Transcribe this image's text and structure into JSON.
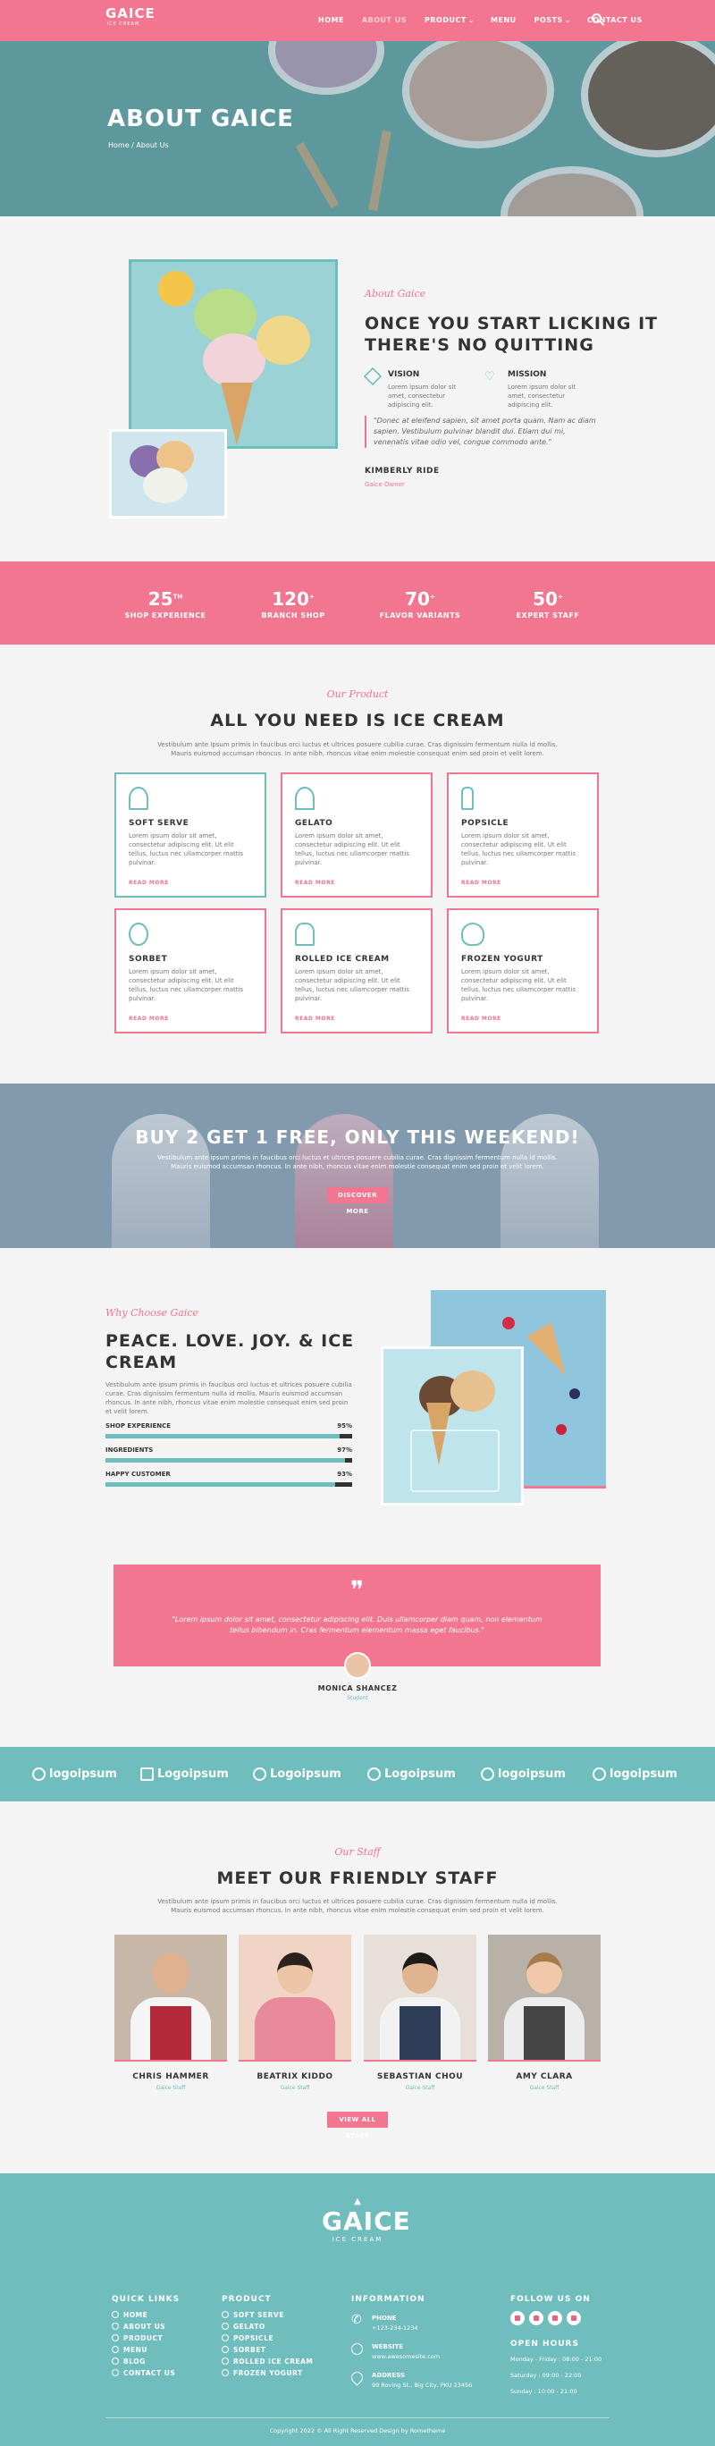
{
  "brand": {
    "name": "GAICE",
    "tagline": "ICE CREAM"
  },
  "nav": [
    "HOME",
    "ABOUT US",
    "PRODUCT",
    "MENU",
    "POSTS",
    "CONTACT US"
  ],
  "hero": {
    "title": "ABOUT GAICE",
    "breadcrumb": "Home / About Us"
  },
  "about": {
    "script": "About Gaice",
    "title1": "ONCE YOU START LICKING IT",
    "title2": "THERE'S NO QUITTING",
    "vision": "VISION",
    "vision_text": "Lorem ipsum dolor sit amet, consectetur adipiscing elit.",
    "mission": "MISSION",
    "mission_text": "Lorem ipsum dolor sit amet, consectetur adipiscing elit.",
    "quote": "\"Donec at eleifend sapien, sit amet porta quam. Nam ac diam sapien. Vestibulum pulvinar blandit dui. Etiam dui mi, venenatis vitae odio vel, congue commodo ante.\"",
    "name": "KIMBERLY RIDE",
    "role": "Gaice Owner"
  },
  "stats": [
    {
      "n": "25",
      "s": "TH",
      "l": "SHOP EXPERIENCE"
    },
    {
      "n": "120",
      "s": "+",
      "l": "BRANCH SHOP"
    },
    {
      "n": "70",
      "s": "+",
      "l": "FLAVOR VARIANTS"
    },
    {
      "n": "50",
      "s": "+",
      "l": "EXPERT STAFF"
    }
  ],
  "products": {
    "script": "Our Product",
    "title": "ALL YOU NEED IS ICE CREAM",
    "desc": "Vestibulum ante ipsum primis in faucibus orci luctus et ultrices posuere cubilia curae. Cras dignissim fermentum nulla id mollis. Mauris euismod accumsan rhoncus. In ante nibh, rhoncus vitae enim molestie consequat enim sed proin et velit lorem.",
    "items": [
      {
        "t": "SOFT SERVE"
      },
      {
        "t": "GELATO"
      },
      {
        "t": "POPSICLE"
      },
      {
        "t": "SORBET"
      },
      {
        "t": "ROLLED ICE CREAM"
      },
      {
        "t": "FROZEN YOGURT"
      }
    ],
    "item_text": "Lorem ipsum dolor sit amet, consectetur adipiscing elit. Ut elit tellus, luctus nec ullamcorper mattis pulvinar.",
    "read": "READ MORE"
  },
  "promo": {
    "title": "BUY 2 GET 1 FREE, ONLY THIS WEEKEND!",
    "desc": "Vestibulum ante ipsum primis in faucibus orci luctus et ultrices posuere cubilia curae. Cras dignissim fermentum nulla id mollis. Mauris euismod accumsan rhoncus. In ante nibh, rhoncus vitae enim molestie consequat enim sed proin et velit lorem.",
    "button": "DISCOVER MORE"
  },
  "why": {
    "script": "Why Choose Gaice",
    "title1": "PEACE. LOVE. JOY. & ICE",
    "title2": "CREAM",
    "desc": "Vestibulum ante ipsum primis in faucibus orci luctus et ultrices posuere cubilia curae. Cras dignissim fermentum nulla id mollis. Mauris euismod accumsan rhoncus. In ante nibh, rhoncus vitae enim molestie consequat enim sed proin et velit lorem.",
    "bars": [
      {
        "l": "SHOP EXPERIENCE",
        "p": "95%",
        "v": 95
      },
      {
        "l": "INGREDIENTS",
        "p": "97%",
        "v": 97
      },
      {
        "l": "HAPPY CUSTOMER",
        "p": "93%",
        "v": 93
      }
    ]
  },
  "testimonial": {
    "quote": "\"Lorem ipsum dolor sit amet, consectetur adipiscing elit. Duis ullamcorper diam quam, non elementum tellus bibendum in. Cras fermentum elementum massa eget faucibus.\"",
    "name": "MONICA SHANCEZ",
    "role": "Student"
  },
  "logos": [
    "logoipsum",
    "Logoipsum",
    "Logoipsum",
    "Logoipsum",
    "logoipsum",
    "logoipsum"
  ],
  "staff": {
    "script": "Our Staff",
    "title": "MEET OUR FRIENDLY STAFF",
    "desc": "Vestibulum ante ipsum primis in faucibus orci luctus et ultrices posuere cubilia curae. Cras dignissim fermentum nulla id mollis. Mauris euismod accumsan rhoncus. In ante nibh, rhoncus vitae enim molestie consequat enim sed proin et velit lorem.",
    "people": [
      {
        "n": "CHRIS HAMMER",
        "r": "Gaice Staff"
      },
      {
        "n": "BEATRIX KIDDO",
        "r": "Gaice Staff"
      },
      {
        "n": "SEBASTIAN CHOU",
        "r": "Gaice Staff"
      },
      {
        "n": "AMY CLARA",
        "r": "Gaice Staff"
      }
    ],
    "button": "VIEW ALL STAFF"
  },
  "footer": {
    "quick": "QUICK LINKS",
    "quick_items": [
      "HOME",
      "ABOUT US",
      "PRODUCT",
      "MENU",
      "BLOG",
      "CONTACT US"
    ],
    "product": "PRODUCT",
    "product_items": [
      "SOFT SERVE",
      "GELATO",
      "POPSICLE",
      "SORBET",
      "ROLLED ICE CREAM",
      "FROZEN YOGURT"
    ],
    "info": "INFORMATION",
    "phone_l": "PHONE",
    "phone": "+123-234-1234",
    "web_l": "WEBSITE",
    "web": "www.awesomesite.com",
    "addr_l": "ADDRESS",
    "addr": "99 Roving St., Big City, PKU 23456",
    "follow": "FOLLOW US ON",
    "hours": "OPEN HOURS",
    "h1": "Monday - Friday : 08:00 - 21:00",
    "h2": "Saturday : 09:00 - 22:00",
    "h3": "Sunday : 10:00 - 21:00",
    "copy": "Copyright 2022 © All Right Reserved Design by Rometheme"
  },
  "colors": {
    "pink": "#f37690",
    "teal": "#6fbdbd"
  }
}
